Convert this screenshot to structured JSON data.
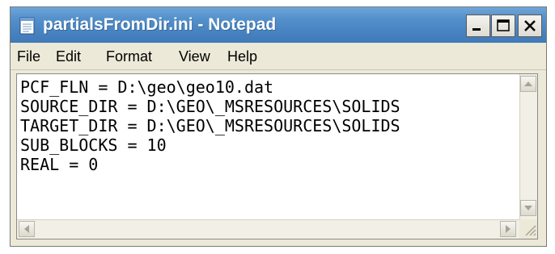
{
  "window": {
    "title": "partialsFromDir.ini - Notepad",
    "title_color": "#ffffff",
    "titlebar_color": "#4a86c4"
  },
  "controls": {
    "minimize_icon": "minimize-icon",
    "maximize_icon": "maximize-icon",
    "close_icon": "close-icon"
  },
  "menu": {
    "items": [
      {
        "label": "File"
      },
      {
        "label": "Edit"
      },
      {
        "label": "Format"
      },
      {
        "label": "View"
      },
      {
        "label": "Help"
      }
    ]
  },
  "editor": {
    "lines": [
      "PCF_FLN = D:\\geo\\geo10.dat",
      "SOURCE_DIR = D:\\GEO\\_MSRESOURCES\\SOLIDS",
      "TARGET_DIR = D:\\GEO\\_MSRESOURCES\\SOLIDS",
      "SUB_BLOCKS = 10",
      "REAL = 0"
    ]
  }
}
